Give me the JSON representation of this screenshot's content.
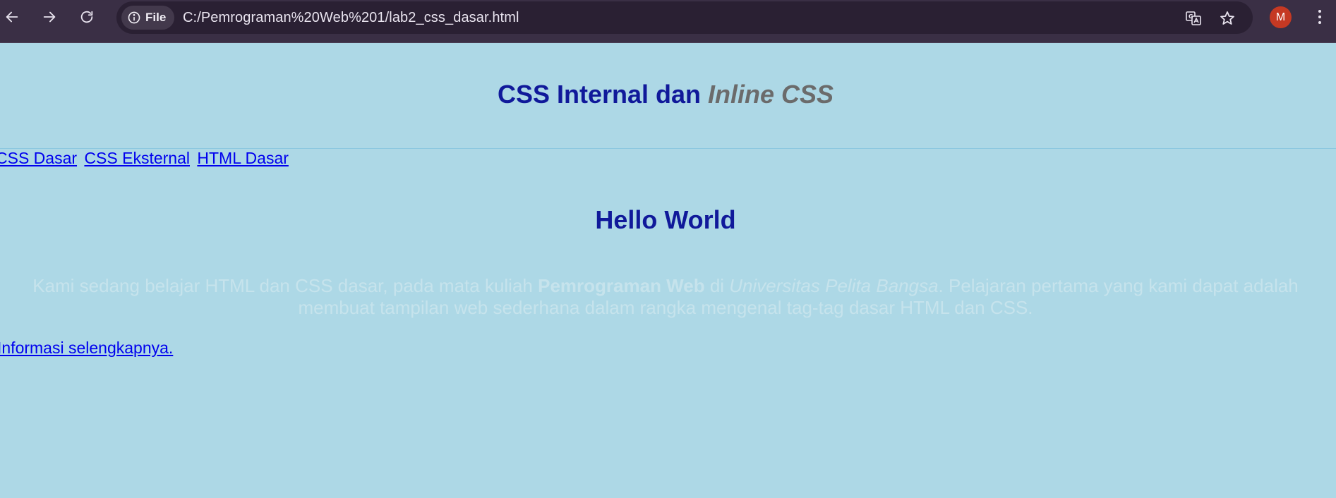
{
  "browser": {
    "site_chip_label": "File",
    "url": "C:/Pemrograman%20Web%201/lab2_css_dasar.html",
    "profile_initial": "M",
    "colors": {
      "chrome_bg": "#3a2f45",
      "omnibox_bg": "#2a2033",
      "avatar_bg": "#c53923"
    },
    "icons": [
      "back-arrow-icon",
      "forward-arrow-icon",
      "reload-icon",
      "info-icon",
      "translate-icon",
      "star-icon",
      "more-vertical-icon"
    ]
  },
  "page": {
    "background": "#add8e6",
    "heading": {
      "part1": "CSS Internal dan ",
      "part2": "Inline CSS"
    },
    "nav_links": [
      {
        "label": "CSS Dasar"
      },
      {
        "label": "CSS Eksternal"
      },
      {
        "label": "HTML Dasar"
      }
    ],
    "subheading": "Hello World",
    "paragraph": {
      "text1": "Kami sedang belajar HTML dan CSS dasar, pada mata kuliah ",
      "bold": "Pemrograman Web",
      "text2": " di ",
      "italic": "Universitas Pelita Bangsa",
      "text3": ". Pelajaran pertama yang kami dapat adalah membuat tampilan web sederhana dalam rangka mengenal tag-tag dasar HTML dan CSS."
    },
    "more_link": "Informasi selengkapnya."
  }
}
